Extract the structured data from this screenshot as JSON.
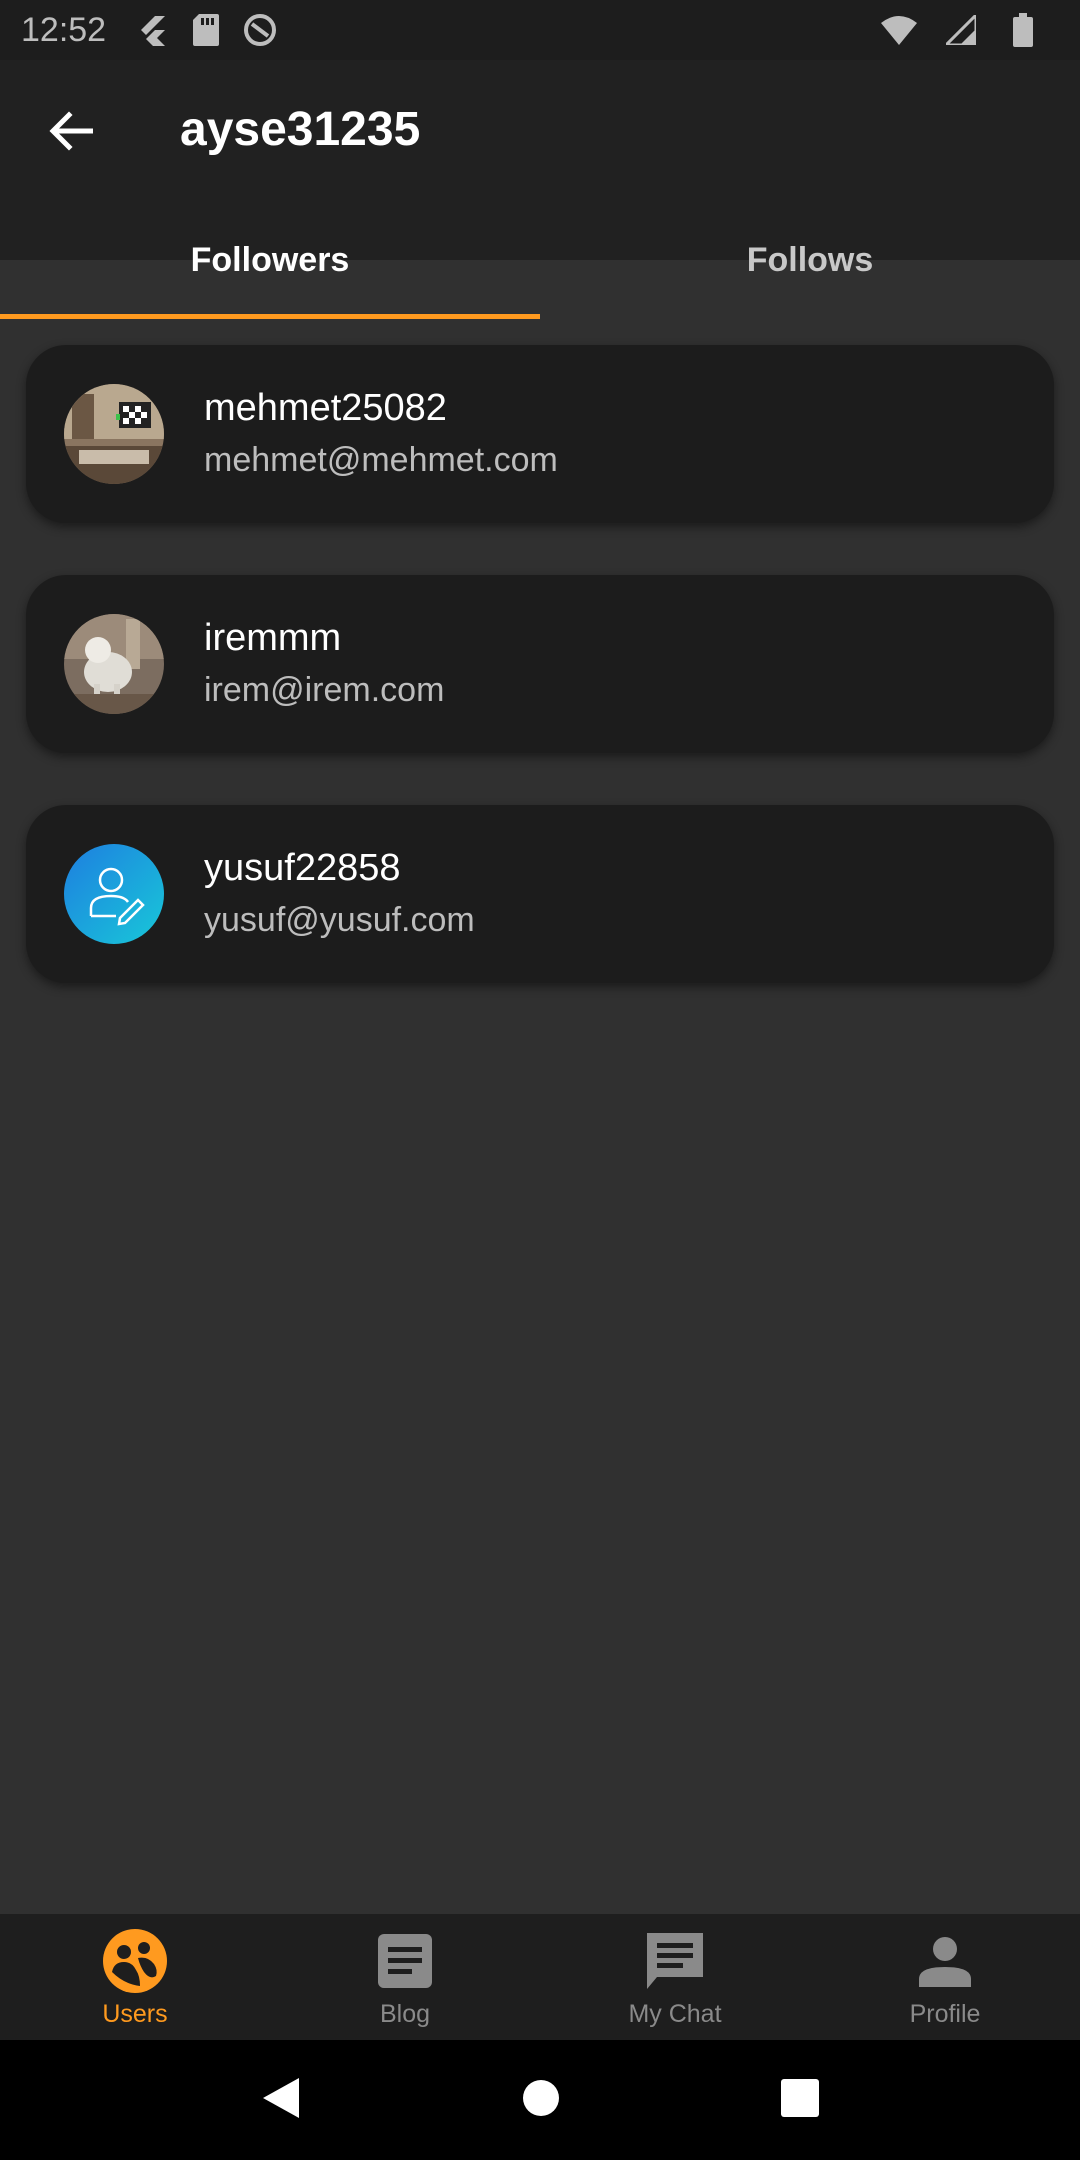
{
  "status_bar": {
    "time": "12:52",
    "icons": [
      "flutter-icon",
      "sd-card-icon",
      "sync-icon",
      "wifi-icon",
      "signal-icon",
      "battery-icon"
    ]
  },
  "app_bar": {
    "back_icon": "arrow-back-icon",
    "title": "ayse31235"
  },
  "tabs": [
    {
      "label": "Followers",
      "active": true
    },
    {
      "label": "Follows",
      "active": false
    }
  ],
  "followers": [
    {
      "username": "mehmet25082",
      "email": "mehmet@mehmet.com",
      "avatar": "room-photo"
    },
    {
      "username": "iremmm",
      "email": "irem@irem.com",
      "avatar": "dog-photo"
    },
    {
      "username": "yusuf22858",
      "email": "yusuf@yusuf.com",
      "avatar": "default-user-edit-icon"
    }
  ],
  "bottom_nav": [
    {
      "label": "Users",
      "icon": "users-icon",
      "active": true
    },
    {
      "label": "Blog",
      "icon": "blog-icon",
      "active": false
    },
    {
      "label": "My Chat",
      "icon": "chat-icon",
      "active": false
    },
    {
      "label": "Profile",
      "icon": "profile-icon",
      "active": false
    }
  ],
  "colors": {
    "accent": "#ff9a1f",
    "background": "#303030",
    "app_bar": "#212121",
    "card": "#1c1c1c"
  }
}
